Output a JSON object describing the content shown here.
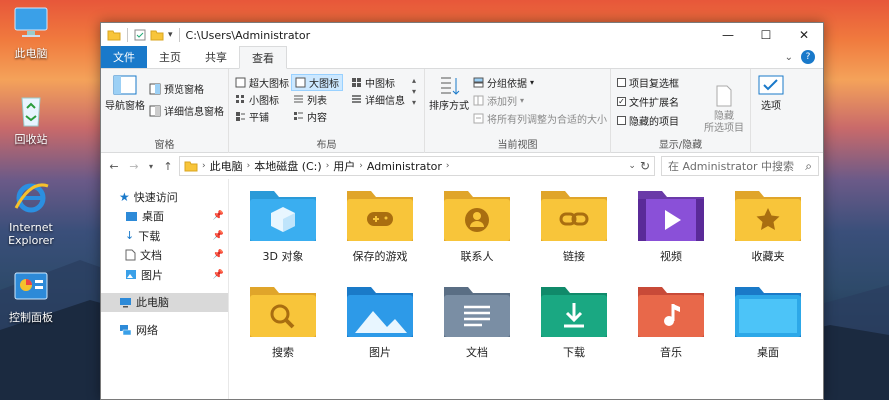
{
  "desktop": {
    "icons": [
      {
        "label": "此电脑"
      },
      {
        "label": "回收站"
      },
      {
        "label": "Internet Explorer"
      },
      {
        "label": "控制面板"
      }
    ]
  },
  "window": {
    "title": "C:\\Users\\Administrator",
    "tabs": [
      "文件",
      "主页",
      "共享",
      "查看"
    ],
    "active_tab": "查看"
  },
  "ribbon": {
    "panes": {
      "label": "窗格",
      "nav_pane": "导航窗格",
      "preview_pane": "预览窗格",
      "details_pane": "详细信息窗格"
    },
    "layout": {
      "label": "布局",
      "items": [
        "超大图标",
        "大图标",
        "中图标",
        "小图标",
        "列表",
        "详细信息",
        "平铺",
        "内容"
      ],
      "selected": "大图标"
    },
    "current_view": {
      "label": "当前视图",
      "sort": "排序方式",
      "group_by": "分组依据",
      "add_columns": "添加列",
      "size_all_columns": "将所有列调整为合适的大小"
    },
    "show_hide": {
      "label": "显示/隐藏",
      "item_checkboxes": "项目复选框",
      "file_name_extensions": "文件扩展名",
      "hidden_items": "隐藏的项目",
      "hide_selected": "隐藏\n所选项目",
      "options": "选项"
    }
  },
  "address_bar": {
    "path": [
      "此电脑",
      "本地磁盘 (C:)",
      "用户",
      "Administrator"
    ],
    "search_placeholder": "在 Administrator 中搜索"
  },
  "nav_pane": {
    "quick_access": "快速访问",
    "pinned": [
      "桌面",
      "下载",
      "文档",
      "图片"
    ],
    "this_pc": "此电脑",
    "network": "网络"
  },
  "folders": [
    {
      "label": "3D 对象",
      "icon": "cube-icon"
    },
    {
      "label": "保存的游戏",
      "icon": "gamepad-icon"
    },
    {
      "label": "联系人",
      "icon": "contact-icon"
    },
    {
      "label": "链接",
      "icon": "link-icon"
    },
    {
      "label": "视频",
      "icon": "play-icon"
    },
    {
      "label": "收藏夹",
      "icon": "star-icon"
    },
    {
      "label": "搜索",
      "icon": "magnifier-icon"
    },
    {
      "label": "图片",
      "icon": "picture-icon"
    },
    {
      "label": "文档",
      "icon": "document-icon"
    },
    {
      "label": "下载",
      "icon": "download-icon"
    },
    {
      "label": "音乐",
      "icon": "music-icon"
    },
    {
      "label": "桌面",
      "icon": "desktop-icon"
    }
  ],
  "colors": {
    "accent": "#1979ca",
    "selection": "#cce8ff",
    "folder_yellow": "#f8c53a"
  }
}
